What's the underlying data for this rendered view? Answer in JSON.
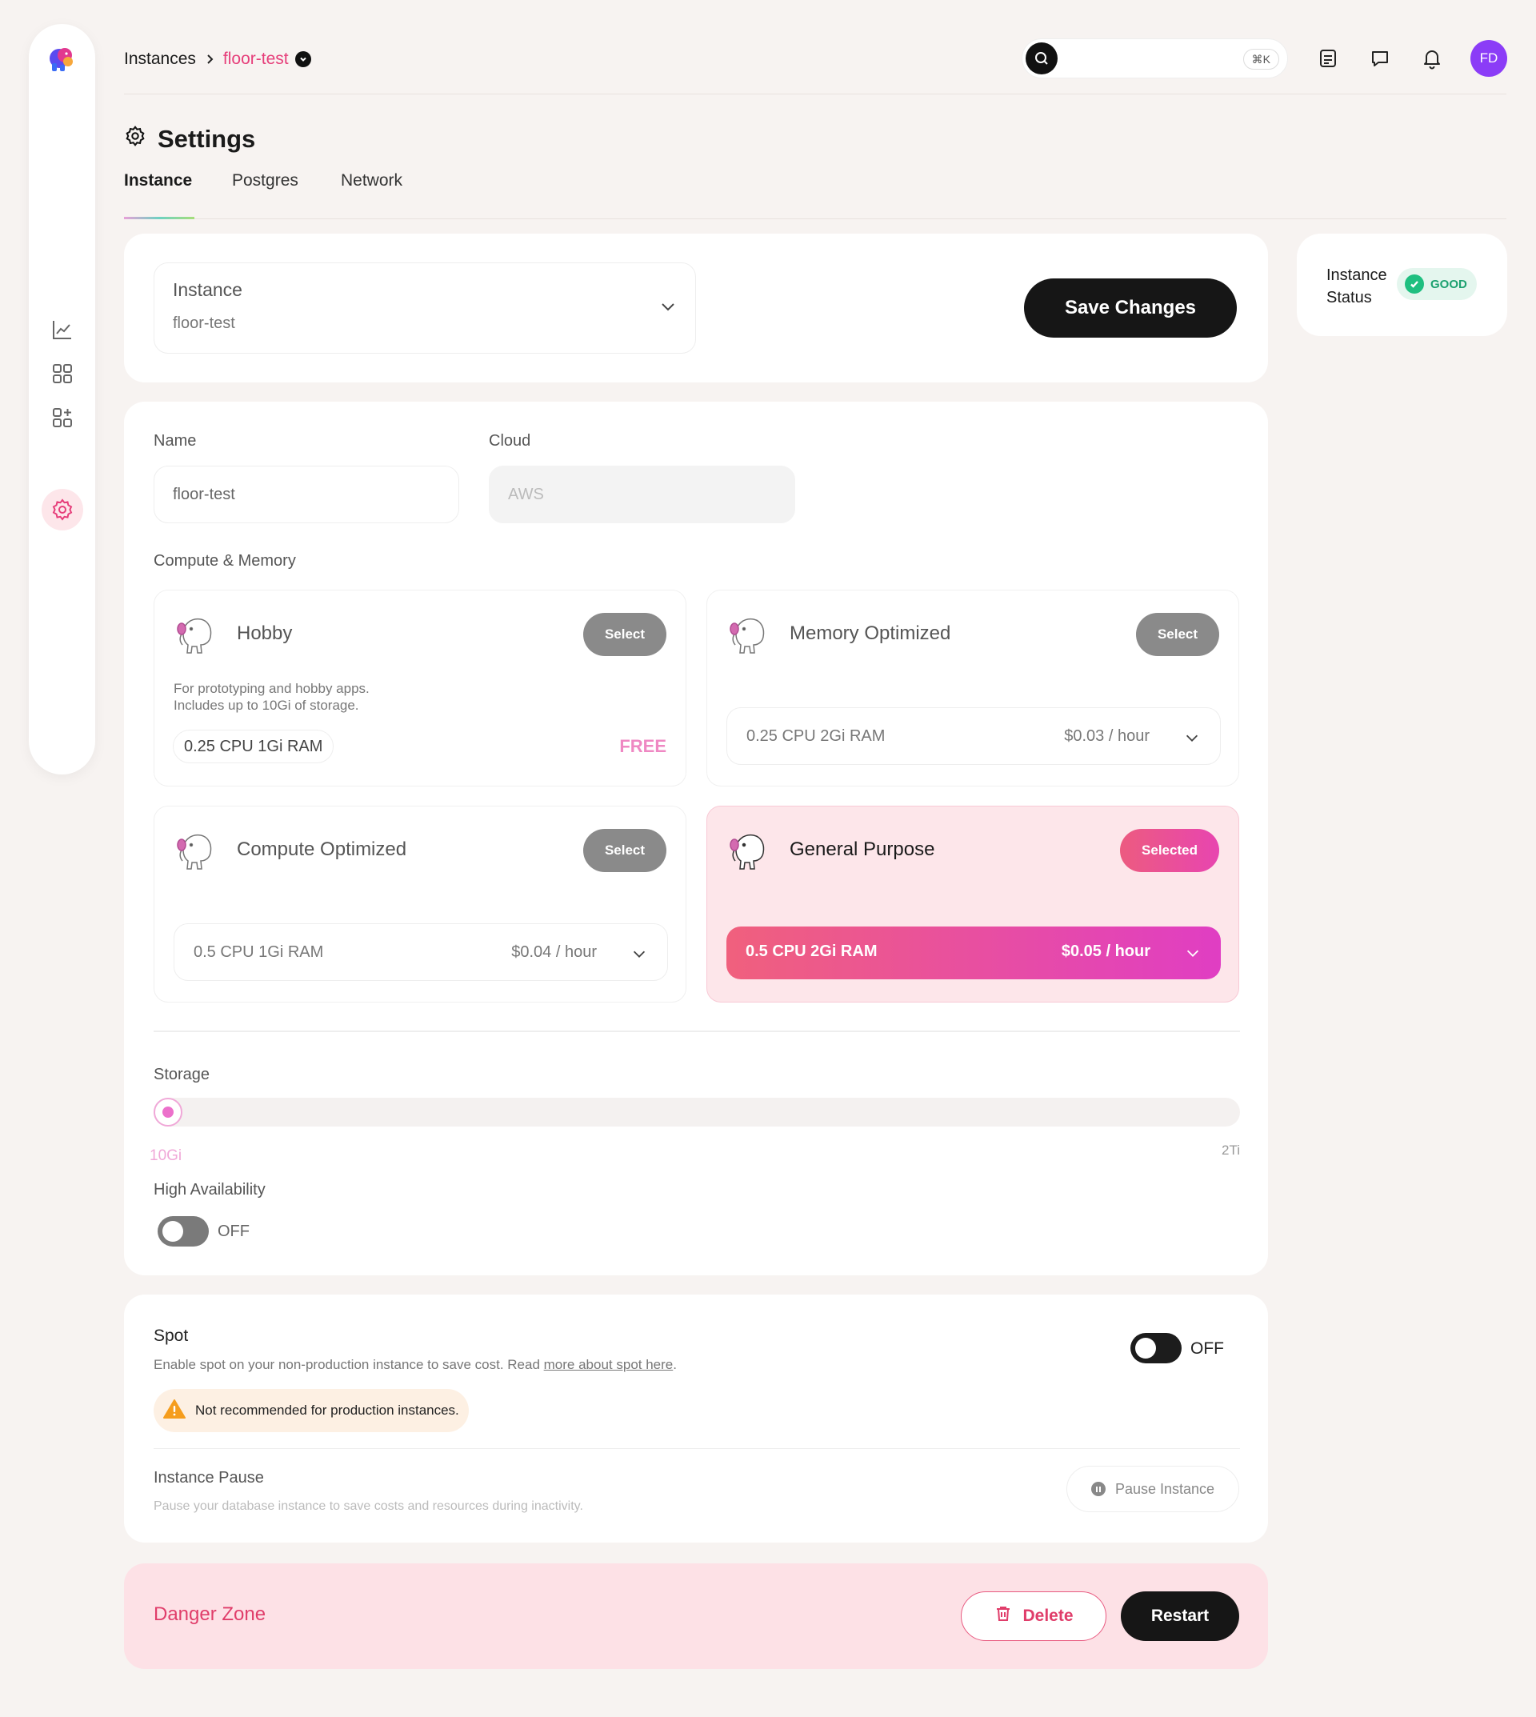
{
  "breadcrumb": {
    "root": "Instances",
    "current": "floor-test"
  },
  "search": {
    "shortcut": "⌘K"
  },
  "user": {
    "initials": "FD"
  },
  "page": {
    "title": "Settings"
  },
  "tabs": [
    {
      "label": "Instance",
      "active": true
    },
    {
      "label": "Postgres",
      "active": false
    },
    {
      "label": "Network",
      "active": false
    }
  ],
  "instance_selector": {
    "label": "Instance",
    "value": "floor-test"
  },
  "actions": {
    "save": "Save Changes",
    "delete": "Delete",
    "restart": "Restart",
    "pause": "Pause Instance"
  },
  "status": {
    "label": "Instance Status",
    "badge": "GOOD"
  },
  "form": {
    "name_label": "Name",
    "name_value": "floor-test",
    "cloud_label": "Cloud",
    "cloud_value": "AWS",
    "compute_label": "Compute & Memory"
  },
  "plans": [
    {
      "name": "Hobby",
      "button": "Select",
      "description_1": "For prototyping and hobby apps.",
      "description_2": "Includes up to 10Gi of storage.",
      "spec": "0.25 CPU 1Gi RAM",
      "price": "FREE",
      "selected": false
    },
    {
      "name": "Memory Optimized",
      "button": "Select",
      "spec": "0.25 CPU 2Gi RAM",
      "price": "$0.03 / hour",
      "selected": false
    },
    {
      "name": "Compute Optimized",
      "button": "Select",
      "spec": "0.5 CPU 1Gi RAM",
      "price": "$0.04 / hour",
      "selected": false
    },
    {
      "name": "General Purpose",
      "button": "Selected",
      "spec": "0.5 CPU 2Gi RAM",
      "price": "$0.05 / hour",
      "selected": true
    }
  ],
  "storage": {
    "label": "Storage",
    "value": "10Gi",
    "max": "2Ti",
    "fraction": 0.0
  },
  "ha": {
    "label": "High Availability",
    "state": "OFF"
  },
  "spot": {
    "title": "Spot",
    "description": "Enable spot on your non-production instance to save cost. Read ",
    "link": "more about spot here",
    "period": ".",
    "state": "OFF",
    "warning": "Not recommended for production instances."
  },
  "pause": {
    "title": "Instance Pause",
    "description": "Pause your database instance to save costs and resources during inactivity."
  },
  "danger": {
    "title": "Danger Zone"
  },
  "colors": {
    "accent": "#e63e7a",
    "dark": "#161616",
    "good": "#1fbf80",
    "danger_bg": "#fde1e6"
  }
}
